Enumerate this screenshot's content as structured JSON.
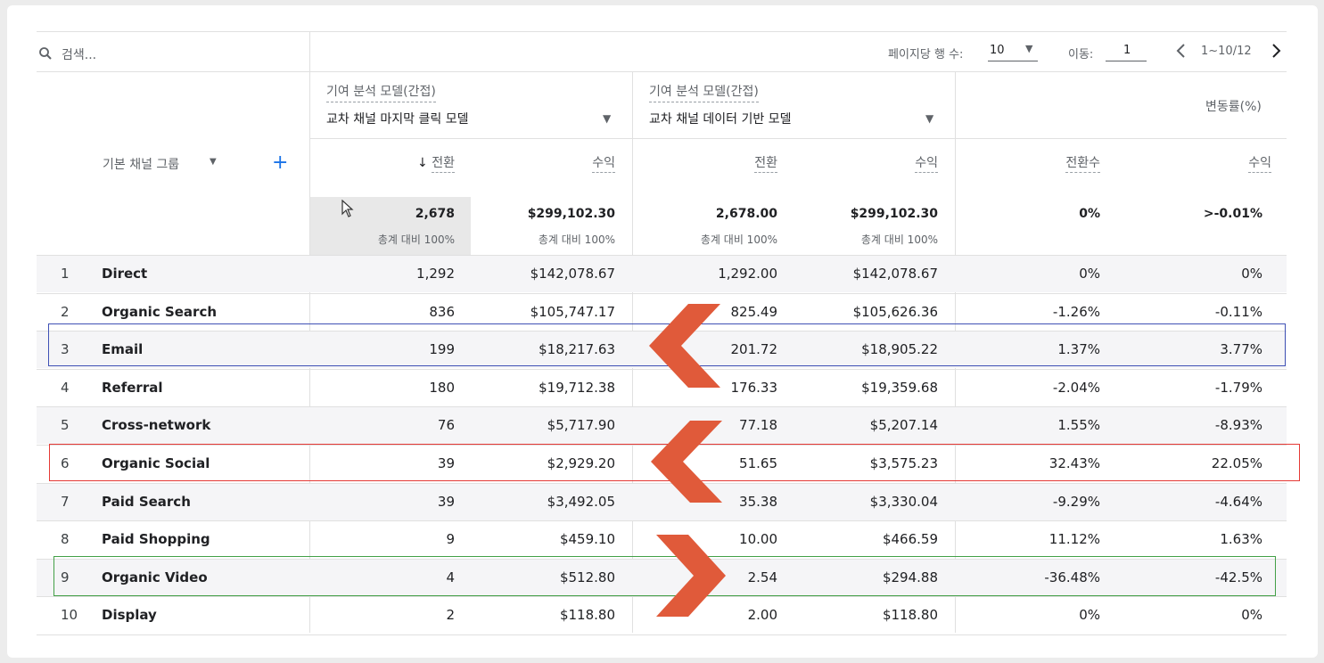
{
  "search": {
    "placeholder": "검색..."
  },
  "pagination": {
    "rows_per_page_label": "페이지당 행 수:",
    "rows_per_page_value": "10",
    "goto_label": "이동:",
    "goto_value": "1",
    "range": "1~10/12"
  },
  "model_left": {
    "label": "기여 분석 모델(간접)",
    "value": "교차 채널 마지막 클릭 모델"
  },
  "model_right": {
    "label": "기여 분석 모델(간접)",
    "value": "교차 채널 데이터 기반 모델"
  },
  "change_header": "변동률(%)",
  "dimension_header": "기본 채널 그룹",
  "columns": {
    "l_conv": "전환",
    "l_rev": "수익",
    "r_conv": "전환",
    "r_rev": "수익",
    "c_conv": "전환수",
    "c_rev": "수익"
  },
  "totals": {
    "l_conv": "2,678",
    "l_conv_sub": "총계 대비 100%",
    "l_rev": "$299,102.30",
    "l_rev_sub": "총계 대비 100%",
    "r_conv": "2,678.00",
    "r_conv_sub": "총계 대비 100%",
    "r_rev": "$299,102.30",
    "r_rev_sub": "총계 대비 100%",
    "c_conv": "0%",
    "c_rev": ">-0.01%"
  },
  "rows": [
    {
      "idx": "1",
      "name": "Direct",
      "l_conv": "1,292",
      "l_rev": "$142,078.67",
      "r_conv": "1,292.00",
      "r_rev": "$142,078.67",
      "c_conv": "0%",
      "c_rev": "0%"
    },
    {
      "idx": "2",
      "name": "Organic Search",
      "l_conv": "836",
      "l_rev": "$105,747.17",
      "r_conv": "825.49",
      "r_rev": "$105,626.36",
      "c_conv": "-1.26%",
      "c_rev": "-0.11%"
    },
    {
      "idx": "3",
      "name": "Email",
      "l_conv": "199",
      "l_rev": "$18,217.63",
      "r_conv": "201.72",
      "r_rev": "$18,905.22",
      "c_conv": "1.37%",
      "c_rev": "3.77%"
    },
    {
      "idx": "4",
      "name": "Referral",
      "l_conv": "180",
      "l_rev": "$19,712.38",
      "r_conv": "176.33",
      "r_rev": "$19,359.68",
      "c_conv": "-2.04%",
      "c_rev": "-1.79%"
    },
    {
      "idx": "5",
      "name": "Cross-network",
      "l_conv": "76",
      "l_rev": "$5,717.90",
      "r_conv": "77.18",
      "r_rev": "$5,207.14",
      "c_conv": "1.55%",
      "c_rev": "-8.93%"
    },
    {
      "idx": "6",
      "name": "Organic Social",
      "l_conv": "39",
      "l_rev": "$2,929.20",
      "r_conv": "51.65",
      "r_rev": "$3,575.23",
      "c_conv": "32.43%",
      "c_rev": "22.05%"
    },
    {
      "idx": "7",
      "name": "Paid Search",
      "l_conv": "39",
      "l_rev": "$3,492.05",
      "r_conv": "35.38",
      "r_rev": "$3,330.04",
      "c_conv": "-9.29%",
      "c_rev": "-4.64%"
    },
    {
      "idx": "8",
      "name": "Paid Shopping",
      "l_conv": "9",
      "l_rev": "$459.10",
      "r_conv": "10.00",
      "r_rev": "$466.59",
      "c_conv": "11.12%",
      "c_rev": "1.63%"
    },
    {
      "idx": "9",
      "name": "Organic Video",
      "l_conv": "4",
      "l_rev": "$512.80",
      "r_conv": "2.54",
      "r_rev": "$294.88",
      "c_conv": "-36.48%",
      "c_rev": "-42.5%"
    },
    {
      "idx": "10",
      "name": "Display",
      "l_conv": "2",
      "l_rev": "$118.80",
      "r_conv": "2.00",
      "r_rev": "$118.80",
      "c_conv": "0%",
      "c_rev": "0%"
    }
  ],
  "colors": {
    "blue_box": "#3f51b5",
    "red_box": "#e53935",
    "green_box": "#43a047",
    "arrow": "#e05a3a",
    "accent": "#1a73e8"
  },
  "icons": {
    "search": "search-icon",
    "dropdown": "caret-down-icon",
    "add": "plus-icon",
    "sort": "arrow-down-icon",
    "prev": "chevron-left-icon",
    "next": "chevron-right-icon",
    "cursor": "mouse-cursor-icon"
  }
}
